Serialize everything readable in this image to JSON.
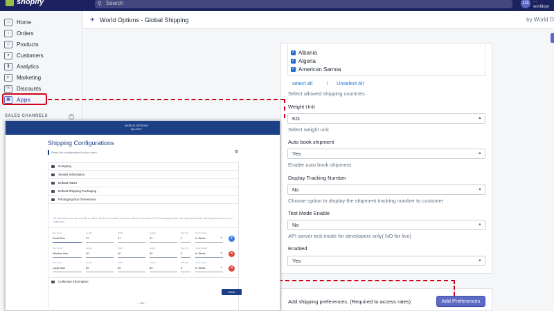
{
  "topbar": {
    "logo": "shopify",
    "search_placeholder": "Search",
    "avatar": "LG",
    "store_name": "worldopt",
    "store_line1": "..."
  },
  "sidebar": {
    "items": [
      {
        "label": "Home",
        "icon": "home-icon"
      },
      {
        "label": "Orders",
        "icon": "orders-icon"
      },
      {
        "label": "Products",
        "icon": "tag-icon"
      },
      {
        "label": "Customers",
        "icon": "customers-icon"
      },
      {
        "label": "Analytics",
        "icon": "analytics-icon"
      },
      {
        "label": "Marketing",
        "icon": "marketing-icon"
      },
      {
        "label": "Discounts",
        "icon": "discount-icon"
      },
      {
        "label": "Apps",
        "icon": "apps-icon"
      }
    ],
    "section_title": "SALES CHANNELS",
    "section_add": "+"
  },
  "app_header": {
    "title": "World Options - Global Shipping",
    "by": "by World O"
  },
  "settings": {
    "countries": [
      "Albania",
      "Algeria",
      "American Samoa"
    ],
    "select_all": "select all",
    "separator": "/",
    "unselect_all": "Unselect All",
    "countries_help": "Select allowed shipping countries",
    "weight_label": "Weight Unit",
    "weight_value": "KG",
    "weight_help": "Select weight unit",
    "autobook_label": "Auto book shipment",
    "autobook_value": "Yes",
    "autobook_help": "Enable auto book shipment",
    "tracking_label": "Display Tracking Number",
    "tracking_value": "No",
    "tracking_help": "Choose option to display the shipment tracking number to customer",
    "testmode_label": "Test Mode Enable",
    "testmode_value": "No",
    "testmode_help": "API server test mode for developers only( NO for live)",
    "enabled_label": "Enabled",
    "enabled_value": "Yes"
  },
  "preferences": {
    "text": "Add shipping preferences. (Required to access rates)",
    "button": "Add Preferences"
  },
  "overlay": {
    "logo_line1": "WORLD OPTIONS",
    "logo_line2": "by LGCY",
    "title": "Shipping Configurations",
    "subtitle": "Setup the configuration for your store.",
    "sections": [
      "Company",
      "Sender Information",
      "Default Rates",
      "Default Shipping Packaging",
      "Packaging Box Dimensions"
    ],
    "note": "All dimensions are user-friendly to match with the box located under the column of the store in the Packaging section. We match previously used to pack and send your shipments.",
    "columns": [
      "Box Name",
      "Length",
      "Width",
      "Height",
      "Max Qty",
      "Stock Status"
    ],
    "boxes": [
      {
        "name": "Small Box",
        "length": "37",
        "width": "37",
        "height": "37",
        "qty": "0",
        "status": "In Stock",
        "action": "+"
      },
      {
        "name": "Medium Box",
        "length": "40",
        "width": "40",
        "height": "40",
        "qty": "0",
        "status": "In Stock",
        "action": "✕"
      },
      {
        "name": "Large Box",
        "length": "60",
        "width": "60",
        "height": "60",
        "qty": "0",
        "status": "In Stock",
        "action": "✕"
      }
    ],
    "collection": "Collection Information",
    "save": "SAVE",
    "or": "-- OR --"
  },
  "colors": {
    "topbar": "#1c2260",
    "accent": "#5c6ac4",
    "highlight": "#d0021b",
    "overlay_header": "#1c3f86"
  }
}
